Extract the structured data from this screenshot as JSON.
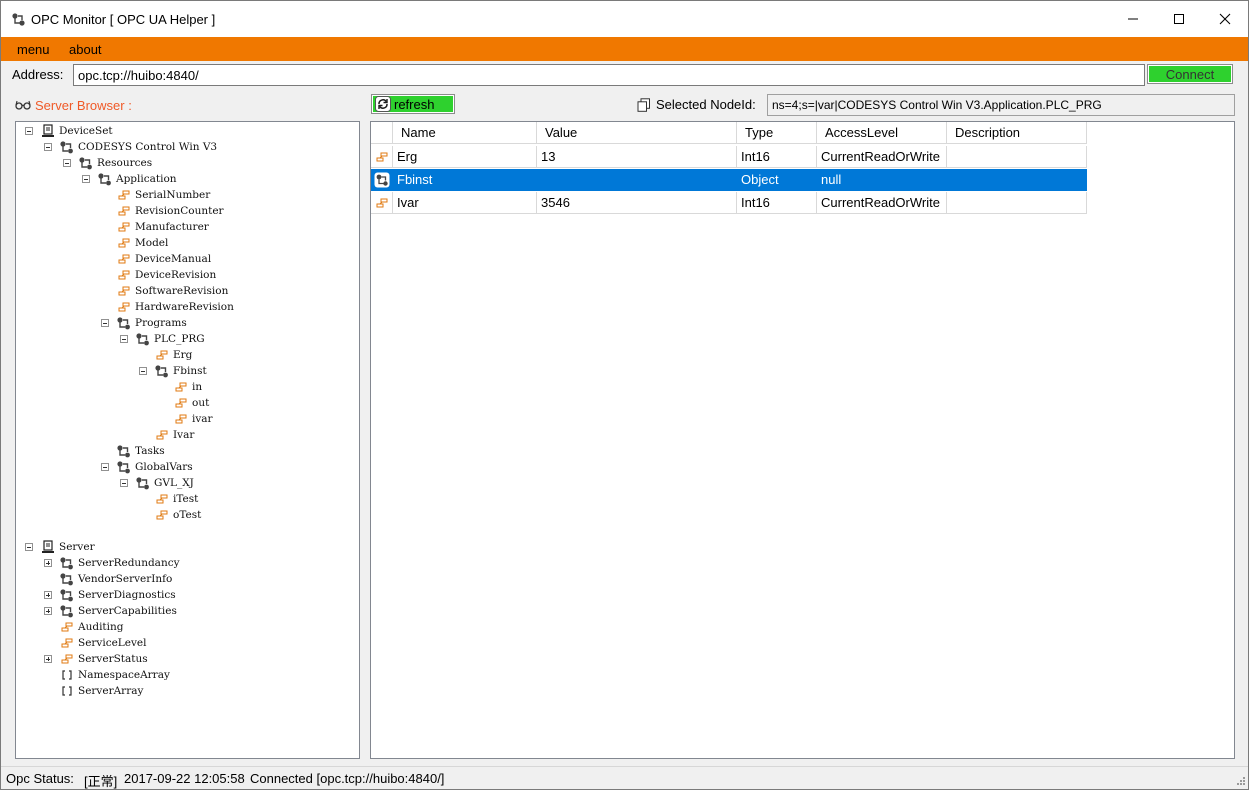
{
  "window": {
    "title": "OPC Monitor [ OPC UA Helper ]",
    "buttons": [
      "minimize",
      "maximize",
      "close"
    ]
  },
  "menu": [
    "menu",
    "about"
  ],
  "address": {
    "label": "Address:",
    "value": "opc.tcp://huibo:4840/",
    "connect_label": "Connect"
  },
  "colors": {
    "menubar": "#f07800",
    "button_green": "#2ed12e",
    "browser_label": "#f05a28",
    "selection": "#0078d7"
  },
  "browser": {
    "label": "Server Browser :",
    "icon": "glasses-icon"
  },
  "toolbar": {
    "refresh_label": "refresh",
    "selected_label": "Selected NodeId:",
    "selected_value": "ns=4;s=|var|CODESYS Control Win V3.Application.PLC_PRG"
  },
  "tree": [
    {
      "label": "DeviceSet",
      "level": 0,
      "icon": "server-icon",
      "expander": "minus"
    },
    {
      "label": "CODESYS Control Win V3",
      "level": 1,
      "icon": "object-icon",
      "expander": "minus"
    },
    {
      "label": "Resources",
      "level": 2,
      "icon": "object-icon",
      "expander": "minus"
    },
    {
      "label": "Application",
      "level": 3,
      "icon": "object-icon",
      "expander": "minus"
    },
    {
      "label": "SerialNumber",
      "level": 4,
      "icon": "variable-icon",
      "expander": "none"
    },
    {
      "label": "RevisionCounter",
      "level": 4,
      "icon": "variable-icon",
      "expander": "none"
    },
    {
      "label": "Manufacturer",
      "level": 4,
      "icon": "variable-icon",
      "expander": "none"
    },
    {
      "label": "Model",
      "level": 4,
      "icon": "variable-icon",
      "expander": "none"
    },
    {
      "label": "DeviceManual",
      "level": 4,
      "icon": "variable-icon",
      "expander": "none"
    },
    {
      "label": "DeviceRevision",
      "level": 4,
      "icon": "variable-icon",
      "expander": "none"
    },
    {
      "label": "SoftwareRevision",
      "level": 4,
      "icon": "variable-icon",
      "expander": "none"
    },
    {
      "label": "HardwareRevision",
      "level": 4,
      "icon": "variable-icon",
      "expander": "none"
    },
    {
      "label": "Programs",
      "level": 4,
      "icon": "object-icon",
      "expander": "minus"
    },
    {
      "label": "PLC_PRG",
      "level": 5,
      "icon": "object-icon",
      "expander": "minus"
    },
    {
      "label": "Erg",
      "level": 6,
      "icon": "variable-icon",
      "expander": "none"
    },
    {
      "label": "Fbinst",
      "level": 6,
      "icon": "object-icon",
      "expander": "minus"
    },
    {
      "label": "in",
      "level": 7,
      "icon": "variable-icon",
      "expander": "none"
    },
    {
      "label": "out",
      "level": 7,
      "icon": "variable-icon",
      "expander": "none"
    },
    {
      "label": "ivar",
      "level": 7,
      "icon": "variable-icon",
      "expander": "none"
    },
    {
      "label": "Ivar",
      "level": 6,
      "icon": "variable-icon",
      "expander": "none"
    },
    {
      "label": "Tasks",
      "level": 4,
      "icon": "object-icon",
      "expander": "none"
    },
    {
      "label": "GlobalVars",
      "level": 4,
      "icon": "object-icon",
      "expander": "minus"
    },
    {
      "label": "GVL_XJ",
      "level": 5,
      "icon": "object-icon",
      "expander": "minus"
    },
    {
      "label": "iTest",
      "level": 6,
      "icon": "variable-icon",
      "expander": "none"
    },
    {
      "label": "oTest",
      "level": 6,
      "icon": "variable-icon",
      "expander": "none"
    },
    {
      "label": "",
      "level": 0,
      "icon": "none",
      "expander": "none"
    },
    {
      "label": "Server",
      "level": 0,
      "icon": "server-icon",
      "expander": "minus"
    },
    {
      "label": "ServerRedundancy",
      "level": 1,
      "icon": "object-icon",
      "expander": "plus"
    },
    {
      "label": "VendorServerInfo",
      "level": 1,
      "icon": "object-icon",
      "expander": "none"
    },
    {
      "label": "ServerDiagnostics",
      "level": 1,
      "icon": "object-icon",
      "expander": "plus"
    },
    {
      "label": "ServerCapabilities",
      "level": 1,
      "icon": "object-icon",
      "expander": "plus"
    },
    {
      "label": "Auditing",
      "level": 1,
      "icon": "variable-icon",
      "expander": "none"
    },
    {
      "label": "ServiceLevel",
      "level": 1,
      "icon": "variable-icon",
      "expander": "none"
    },
    {
      "label": "ServerStatus",
      "level": 1,
      "icon": "variable-icon",
      "expander": "plus"
    },
    {
      "label": "NamespaceArray",
      "level": 1,
      "icon": "array-icon",
      "expander": "none"
    },
    {
      "label": "ServerArray",
      "level": 1,
      "icon": "array-icon",
      "expander": "none"
    }
  ],
  "grid": {
    "columns": [
      "Name",
      "Value",
      "Type",
      "AccessLevel",
      "Description"
    ],
    "rows": [
      {
        "icon": "variable-icon",
        "name": "Erg",
        "value": "13",
        "type": "Int16",
        "access": "CurrentReadOrWrite",
        "description": "",
        "selected": false
      },
      {
        "icon": "object-icon",
        "name": "Fbinst",
        "value": "",
        "type": "Object",
        "access": "null",
        "description": "",
        "selected": true
      },
      {
        "icon": "variable-icon",
        "name": "Ivar",
        "value": "3546",
        "type": "Int16",
        "access": "CurrentReadOrWrite",
        "description": "",
        "selected": false
      }
    ]
  },
  "status": {
    "label": "Opc Status:",
    "state": "[正常]",
    "time": "2017-09-22 12:05:58",
    "message": "Connected [opc.tcp://huibo:4840/]"
  }
}
